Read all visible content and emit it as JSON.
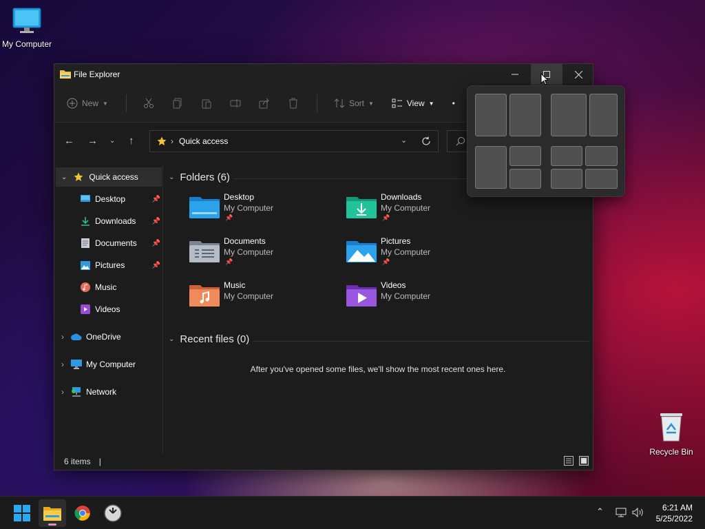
{
  "desktop": {
    "icons": [
      {
        "label": "My Computer"
      },
      {
        "label": "Recycle Bin"
      }
    ]
  },
  "window": {
    "title": "File Explorer",
    "toolbar": {
      "new_label": "New",
      "sort_label": "Sort",
      "view_label": "View"
    },
    "address": {
      "path": "Quick access"
    },
    "sidebar": {
      "items": [
        {
          "label": "Quick access"
        },
        {
          "label": "Desktop"
        },
        {
          "label": "Downloads"
        },
        {
          "label": "Documents"
        },
        {
          "label": "Pictures"
        },
        {
          "label": "Music"
        },
        {
          "label": "Videos"
        },
        {
          "label": "OneDrive"
        },
        {
          "label": "My Computer"
        },
        {
          "label": "Network"
        }
      ]
    },
    "content": {
      "folders_heading": "Folders (6)",
      "folders": [
        {
          "name": "Desktop",
          "location": "My Computer"
        },
        {
          "name": "Downloads",
          "location": "My Computer"
        },
        {
          "name": "Documents",
          "location": "My Computer"
        },
        {
          "name": "Pictures",
          "location": "My Computer"
        },
        {
          "name": "Music",
          "location": "My Computer"
        },
        {
          "name": "Videos",
          "location": "My Computer"
        }
      ],
      "recent_heading": "Recent files (0)",
      "recent_empty": "After you've opened some files, we'll show the most recent ones here."
    },
    "status": {
      "items_count": "6 items",
      "cursor": "|"
    }
  },
  "taskbar": {
    "time": "6:21 AM",
    "date": "5/25/2022"
  },
  "colors": {
    "accent": "#e890b0",
    "window_bg": "#1c1c1c",
    "folder_yellow": "#f4c04a",
    "folder_blue": "#2d9be0"
  }
}
